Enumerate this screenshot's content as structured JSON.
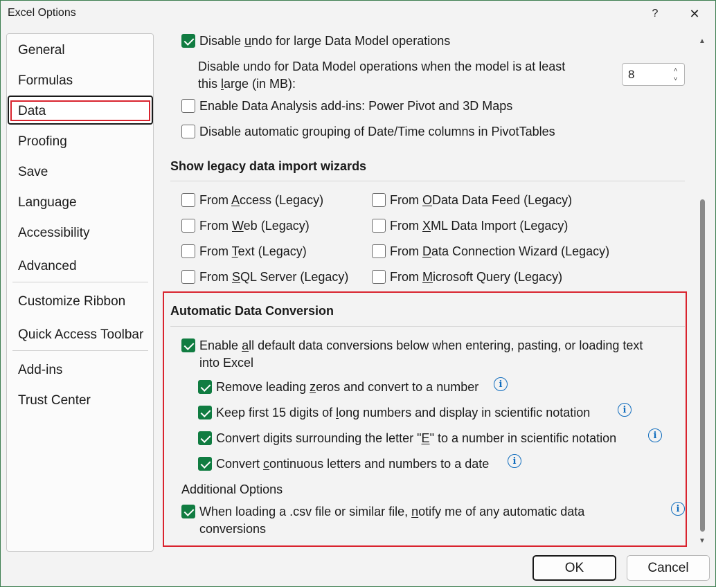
{
  "window": {
    "title": "Excel Options",
    "help": "?",
    "close": "✕"
  },
  "sidebar": {
    "items": [
      {
        "label": "General"
      },
      {
        "label": "Formulas"
      },
      {
        "label": "Data"
      },
      {
        "label": "Proofing"
      },
      {
        "label": "Save"
      },
      {
        "label": "Language"
      },
      {
        "label": "Accessibility"
      },
      {
        "label": "Advanced"
      },
      {
        "label": "Customize Ribbon"
      },
      {
        "label": "Quick Access Toolbar"
      },
      {
        "label": "Add-ins"
      },
      {
        "label": "Trust Center"
      }
    ],
    "selected": "Data"
  },
  "data_model": {
    "disable_undo_large": {
      "pre": "Disable ",
      "u": "u",
      "post": "ndo for large Data Model operations",
      "checked": true
    },
    "threshold_label": {
      "line1": "Disable undo for Data Model operations when the model is at least",
      "l2pre": "this ",
      "l2u": "l",
      "l2post": "arge (in MB):"
    },
    "threshold_value": "8",
    "enable_addins": {
      "pre": "Enable Data Analysis add-ins: Power Pivot and 3D Maps",
      "checked": false
    },
    "disable_grouping": {
      "pre": "Disable automatic ",
      "u": "g",
      "post": "rouping of Date/Time columns in PivotTables",
      "checked": false
    }
  },
  "legacy": {
    "heading": "Show legacy data import wizards",
    "left": [
      {
        "pre": "From ",
        "u": "A",
        "post": "ccess (Legacy)",
        "checked": false
      },
      {
        "pre": "From ",
        "u": "W",
        "post": "eb (Legacy)",
        "checked": false
      },
      {
        "pre": "From ",
        "u": "T",
        "post": "ext (Legacy)",
        "checked": false
      },
      {
        "pre": "From ",
        "u": "S",
        "post": "QL Server (Legacy)",
        "checked": false
      }
    ],
    "right": [
      {
        "pre": "From ",
        "u": "O",
        "post": "Data Data Feed (Legacy)",
        "checked": false
      },
      {
        "pre": "From ",
        "u": "X",
        "post": "ML Data Import (Legacy)",
        "checked": false
      },
      {
        "pre": "From ",
        "u": "D",
        "post": "ata Connection Wizard (Legacy)",
        "checked": false
      },
      {
        "pre": "From ",
        "u": "M",
        "post": "icrosoft Query (Legacy)",
        "checked": false
      }
    ]
  },
  "conversion": {
    "heading": "Automatic Data Conversion",
    "enable_all": {
      "pre": "Enable ",
      "u": "a",
      "post": "ll default data conversions below when entering, pasting, or loading text",
      "line2": "into Excel",
      "checked": true
    },
    "options": [
      {
        "pre": "Remove leading ",
        "u": "z",
        "post": "eros and convert to a number",
        "checked": true
      },
      {
        "pre": "Keep first 15 digits of ",
        "u": "l",
        "post": "ong numbers and display in scientific notation",
        "checked": true
      },
      {
        "pre": "Convert digits surrounding the letter \"",
        "u": "E",
        "post": "\" to a number in scientific notation",
        "checked": true
      },
      {
        "pre": "Convert ",
        "u": "c",
        "post": "ontinuous letters and numbers to a date",
        "checked": true
      }
    ],
    "additional_heading": "Additional Options",
    "csv_notify": {
      "pre": "When loading a .csv file or similar file, ",
      "u": "n",
      "post": "otify me of any automatic data",
      "line2": "conversions",
      "checked": true
    }
  },
  "info_icon": "i",
  "scroll": {
    "up": "▲",
    "down": "▼"
  },
  "spinner": {
    "up": "˄",
    "down": "˅"
  },
  "buttons": {
    "ok": "OK",
    "cancel": "Cancel"
  }
}
